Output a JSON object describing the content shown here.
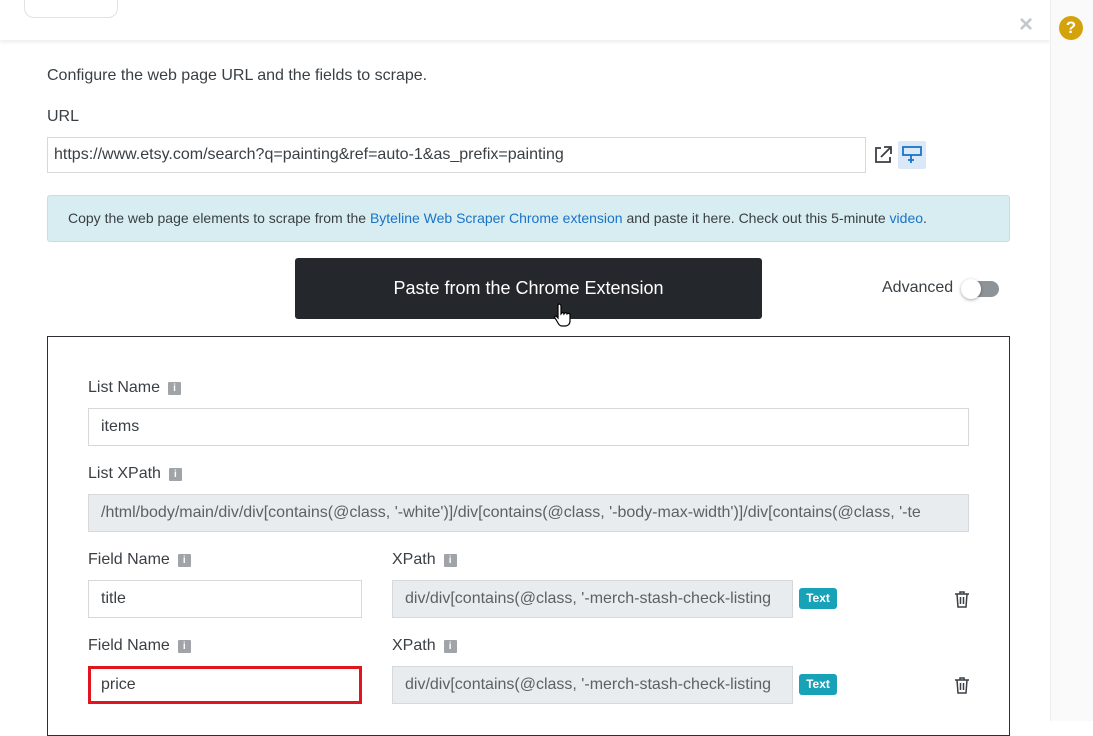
{
  "close_symbol": "×",
  "help_symbol": "?",
  "intro_text": "Configure the web page URL and the fields to scrape.",
  "url_label": "URL",
  "url_value": "https://www.etsy.com/search?q=painting&ref=auto-1&as_prefix=painting",
  "banner": {
    "before": "Copy the web page elements to scrape from the ",
    "link1": "Byteline Web Scraper Chrome extension",
    "middle": " and paste it here. Check out this 5-minute ",
    "link2": "video",
    "after": "."
  },
  "paste_button": "Paste from the Chrome Extension",
  "advanced_label": "Advanced",
  "advanced_on": false,
  "list": {
    "name_label": "List Name",
    "name_value": "items",
    "xpath_label": "List XPath",
    "xpath_value": "/html/body/main/div/div[contains(@class, '-white')]/div[contains(@class, '-body-max-width')]/div[contains(@class, '-te"
  },
  "info_glyph": "i",
  "fields": [
    {
      "name_label": "Field Name",
      "name_value": "title",
      "xpath_label": "XPath",
      "xpath_value": "div/div[contains(@class, '-merch-stash-check-listing",
      "badge": "Text"
    },
    {
      "name_label": "Field Name",
      "name_value": "price",
      "xpath_label": "XPath",
      "xpath_value": "div/div[contains(@class, '-merch-stash-check-listing",
      "badge": "Text"
    }
  ],
  "colors": {
    "accent_link": "#1a73c8",
    "badge": "#17a2b8",
    "highlight": "#e0161f",
    "help": "#d4a20a"
  }
}
